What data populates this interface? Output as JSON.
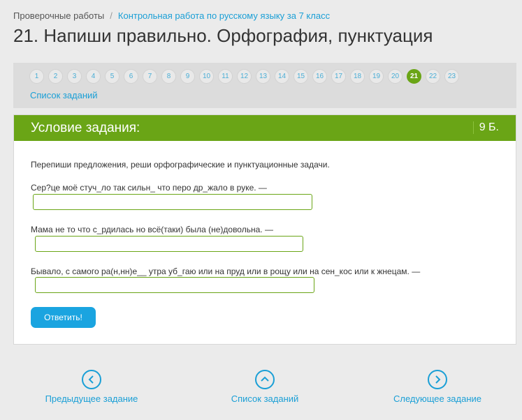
{
  "breadcrumb": {
    "root": "Проверочные работы",
    "separator": "/",
    "current": "Контрольная работа по русскому языку за 7 класс"
  },
  "page_title": "21. Напиши правильно. Орфография, пунктуация",
  "pagination": {
    "pages": [
      "1",
      "2",
      "3",
      "4",
      "5",
      "6",
      "7",
      "8",
      "9",
      "10",
      "11",
      "12",
      "13",
      "14",
      "15",
      "16",
      "17",
      "18",
      "19",
      "20",
      "21",
      "22",
      "23"
    ],
    "active": "21",
    "task_list_link": "Список заданий"
  },
  "task": {
    "header": "Условие задания:",
    "points": "9 Б.",
    "instruction": "Перепиши предложения, реши орфографические и пунктуационные задачи.",
    "questions": [
      {
        "text": "Сер?це моё стуч_ло так сильн_ что перо др_жало в руке. —",
        "value": ""
      },
      {
        "text": "Мама не то что с_рдилась но всё(таки) была (не)довольна. —",
        "value": ""
      },
      {
        "text": "Бывало, с самого ра(н,нн)е__ утра уб_гаю или на пруд или в рощу или на сен_кос или к жнецам. —",
        "value": ""
      }
    ],
    "submit_label": "Ответить!"
  },
  "bottom_nav": {
    "prev_label": "Предыдущее задание",
    "list_label": "Список заданий",
    "next_label": "Следующее задание"
  },
  "colors": {
    "accent_green": "#6aa516",
    "link_blue": "#1a9fd6"
  }
}
